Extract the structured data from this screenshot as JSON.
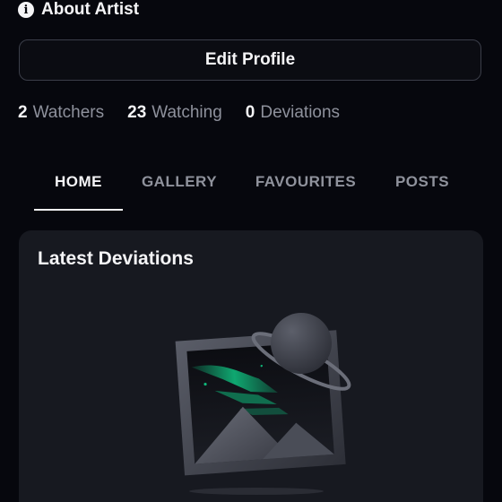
{
  "about": {
    "label": "About Artist",
    "icon": "info-icon"
  },
  "edit_profile": {
    "label": "Edit Profile"
  },
  "stats": [
    {
      "count": "2",
      "label": "Watchers"
    },
    {
      "count": "23",
      "label": "Watching"
    },
    {
      "count": "0",
      "label": "Deviations"
    }
  ],
  "tabs": [
    {
      "label": "HOME",
      "active": true
    },
    {
      "label": "GALLERY",
      "active": false
    },
    {
      "label": "FAVOURITES",
      "active": false
    },
    {
      "label": "POSTS",
      "active": false
    }
  ],
  "latest": {
    "title": "Latest Deviations",
    "illustration": "empty-gallery-illustration"
  },
  "colors": {
    "background": "#06070d",
    "card": "#171920",
    "accent_green": "#0fb87a",
    "text": "#f4f4f6",
    "muted": "#8f929c"
  }
}
